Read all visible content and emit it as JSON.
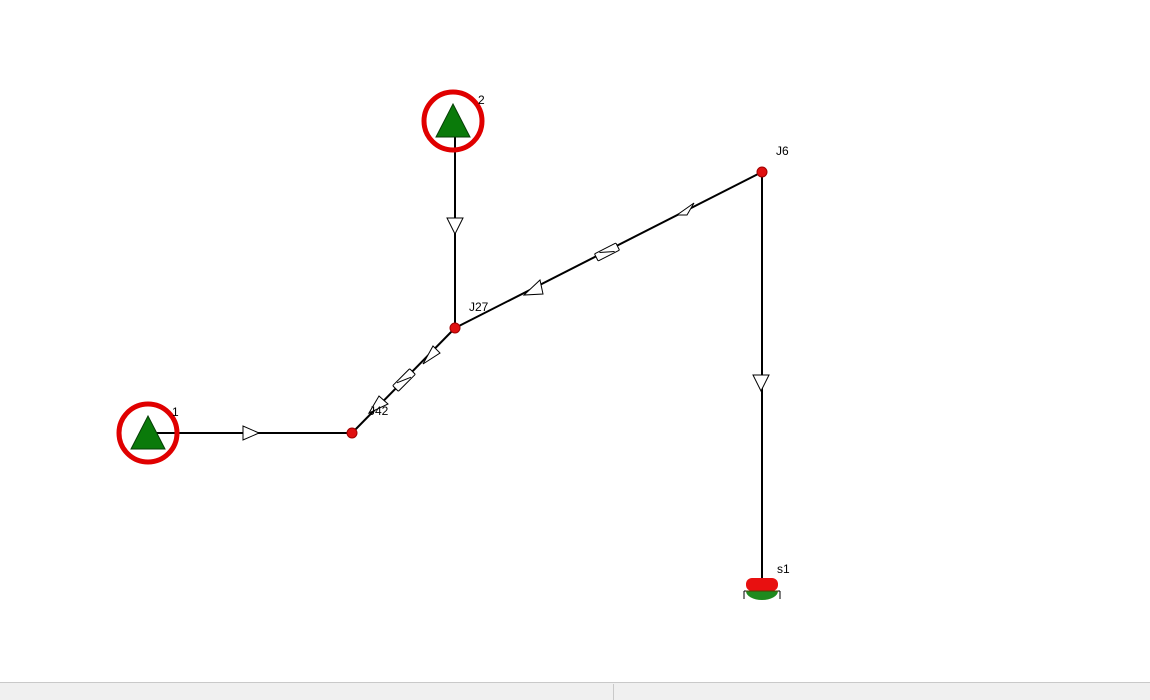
{
  "colors": {
    "source_fill": "#0a7a0a",
    "highlight_ring": "#e00000",
    "junction_fill": "#e01010",
    "junction_stroke": "#a00000",
    "pipe": "#000000",
    "sink_top": "#e81010",
    "sink_bottom": "#1e8a1e",
    "status_bar": "#f0f0f0"
  },
  "network": {
    "source_1": {
      "label": "1",
      "icon": "triangle-source-icon",
      "highlighted": true
    },
    "source_2": {
      "label": "2",
      "icon": "triangle-source-icon",
      "highlighted": true
    },
    "junction_j42": {
      "label": "J42"
    },
    "junction_j27": {
      "label": "J27"
    },
    "junction_j6": {
      "label": "J6"
    },
    "sink_s1": {
      "label": "s1",
      "icon": "sink-tank-icon"
    }
  },
  "status_bar": {
    "panes": [
      "",
      ""
    ]
  }
}
